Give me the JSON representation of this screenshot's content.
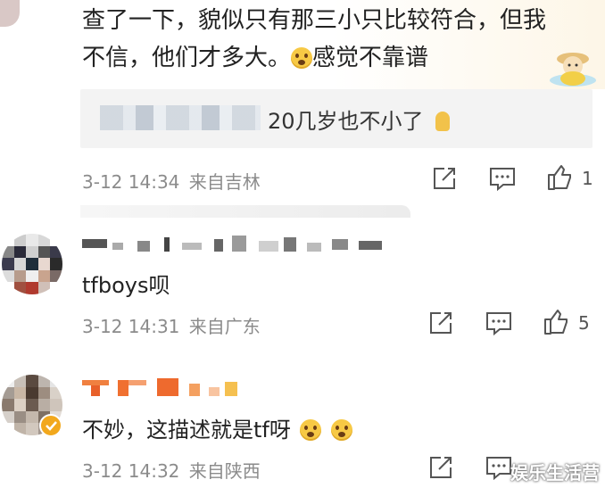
{
  "top_comment": {
    "line1": "查了一下，貌似只有那三小只比较符合，但我",
    "line2_a": "不信，他们才多大。",
    "line2_b": "感觉不靠谱",
    "reply_tail": "20几岁也不小了",
    "date": "3-12",
    "time": "14:34",
    "source": "来自吉林",
    "likes": "1"
  },
  "comment2": {
    "text": "tfboys呗",
    "date": "3-12",
    "time": "14:31",
    "source": "来自广东",
    "likes": "5"
  },
  "comment3": {
    "text": "不妙，这描述就是tf呀",
    "date": "3-12",
    "time": "14:32",
    "source": "来自陕西"
  },
  "watermark": "娱乐生活营",
  "icons": [
    "repost-icon",
    "comment-icon",
    "thumbs-up-icon",
    "laugh-emoji-icon",
    "shocked-emoji-icon",
    "verified-icon",
    "sticker-icon"
  ]
}
